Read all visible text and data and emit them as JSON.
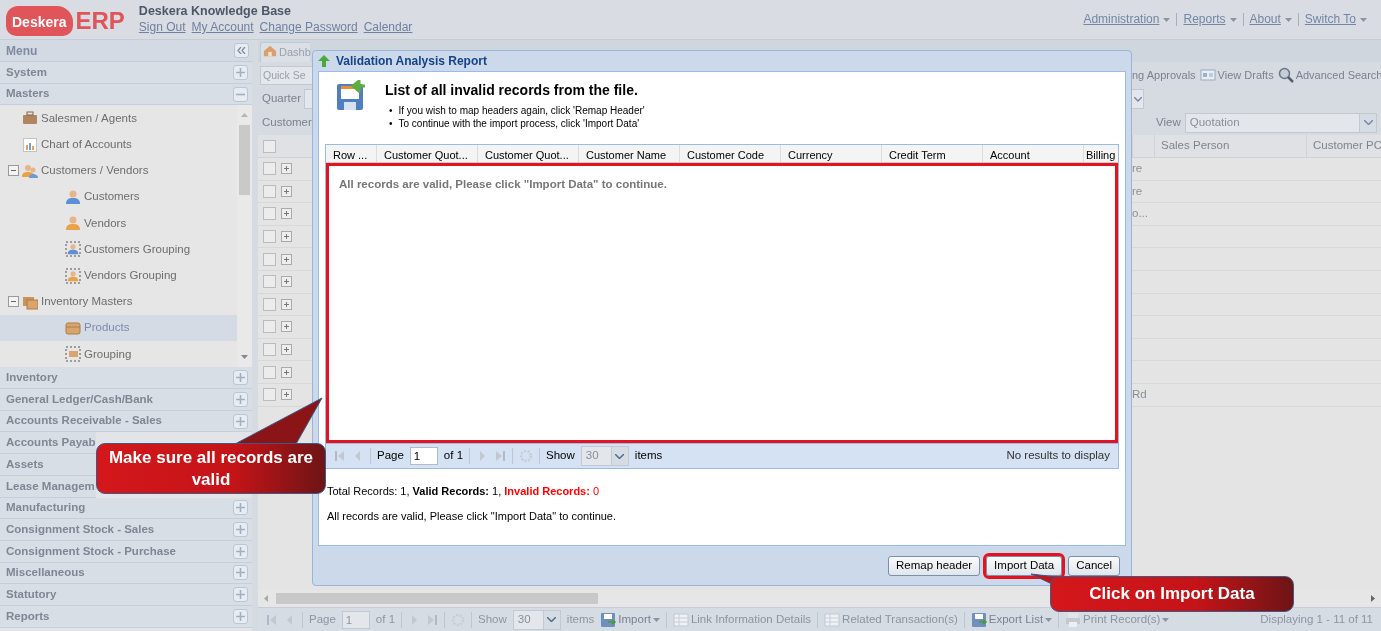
{
  "header": {
    "logo": {
      "wordmark": "Deskera",
      "suffix": "ERP"
    },
    "title": "Deskera Knowledge Base",
    "links": [
      "Sign Out",
      "My Account",
      "Change Password",
      "Calendar"
    ],
    "menu": [
      "Administration",
      "Reports",
      "About",
      "Switch To"
    ]
  },
  "sidebar": {
    "title": "Menu",
    "sections": [
      {
        "label": "System",
        "expanded": false
      },
      {
        "label": "Masters",
        "expanded": true,
        "children": [
          {
            "label": "Salesmen / Agents",
            "kind": "briefcase",
            "selected": false
          },
          {
            "label": "Chart of Accounts",
            "kind": "chart",
            "selected": false
          },
          {
            "label": "Customers / Vendors",
            "kind": "people",
            "selected": false,
            "expanded": true,
            "children": [
              {
                "label": "Customers",
                "kind": "customer",
                "selected": false
              },
              {
                "label": "Vendors",
                "kind": "vendor",
                "selected": false
              },
              {
                "label": "Customers Grouping",
                "kind": "customer-group",
                "selected": false
              },
              {
                "label": "Vendors Grouping",
                "kind": "vendor-group",
                "selected": false
              }
            ]
          },
          {
            "label": "Inventory Masters",
            "kind": "inventory",
            "selected": false,
            "expanded": true,
            "children": [
              {
                "label": "Products",
                "kind": "product",
                "selected": true
              },
              {
                "label": "Grouping",
                "kind": "group",
                "selected": false
              }
            ]
          }
        ]
      },
      {
        "label": "Inventory",
        "expanded": false
      },
      {
        "label": "General Ledger/Cash/Bank",
        "expanded": false
      },
      {
        "label": "Accounts Receivable - Sales",
        "expanded": false
      },
      {
        "label": "Accounts Payab"
      },
      {
        "label": "Assets"
      },
      {
        "label": "Lease Managem"
      },
      {
        "label": "Manufacturing",
        "expanded": false
      },
      {
        "label": "Consignment Stock - Sales",
        "expanded": false
      },
      {
        "label": "Consignment Stock - Purchase",
        "expanded": false
      },
      {
        "label": "Miscellaneous",
        "expanded": false
      },
      {
        "label": "Statutory",
        "expanded": false
      },
      {
        "label": "Reports",
        "expanded": false
      }
    ]
  },
  "tabs": [
    {
      "label": "Dashb",
      "selected": false,
      "kind": "dashboard"
    }
  ],
  "toolbar": {
    "search": {
      "placeholder": "Quick Se"
    },
    "actions": [
      "ng Approvals",
      "View Drafts",
      "Advanced Search"
    ],
    "quarter": {
      "label": "Quarter"
    },
    "customer_label": "Customer",
    "view": {
      "label": "View",
      "value": "Quotation"
    }
  },
  "grid": {
    "all_checked": false,
    "columns": [
      "Sales Person",
      "Customer PO"
    ],
    "rows": [
      {
        "checked": false,
        "column_1": "re"
      },
      {
        "checked": false,
        "column_1": "re"
      },
      {
        "checked": false,
        "column_1": "o..."
      },
      {
        "checked": false
      },
      {
        "checked": false
      },
      {
        "checked": false
      },
      {
        "checked": false
      },
      {
        "checked": false
      },
      {
        "checked": false
      },
      {
        "checked": false
      },
      {
        "checked": false,
        "column_1": "Rd"
      }
    ]
  },
  "pager": {
    "page_label": "Page",
    "page": "1",
    "of": "of 1",
    "show_label": "Show",
    "page_size": "30",
    "items_label": "items",
    "actions": [
      {
        "label": "Import",
        "disabled": false,
        "menu": true,
        "kind": "import"
      },
      {
        "label": "Link Information Details",
        "disabled": true,
        "menu": false,
        "kind": "sheet"
      },
      {
        "label": "Related Transaction(s)",
        "disabled": true,
        "menu": false,
        "kind": "sheet"
      },
      {
        "label": "Export List",
        "disabled": false,
        "menu": true,
        "kind": "import"
      },
      {
        "label": "Print Record(s)",
        "disabled": true,
        "menu": true,
        "kind": "print"
      }
    ],
    "status": "Displaying 1 - 11 of 11"
  },
  "dialog": {
    "title": "Validation Analysis Report",
    "heading": "List of all invalid records from the file.",
    "bullets": [
      {
        "marker": "•",
        "text": "If you wish to map headers again, click 'Remap Header'"
      },
      {
        "marker": "•",
        "text": "To continue with the import process, click 'Import Data'"
      }
    ],
    "columns": [
      "Row ...",
      "Customer Quot...",
      "Customer Quot...",
      "Customer Name",
      "Customer Code",
      "Currency",
      "Credit Term",
      "Account",
      "Billing"
    ],
    "empty_text": "All records are valid, Please click \"Import Data\" to continue.",
    "highlighted": true,
    "paging": {
      "page_label": "Page",
      "page": "1",
      "of": "of 1",
      "show_label": "Show",
      "page_size": "30",
      "items_label": "items",
      "status": "No results to display"
    },
    "summary": [
      {
        "text": "Total Records: 1, ",
        "kind": "plain"
      },
      {
        "text": "Valid Records:",
        "kind": "bold"
      },
      {
        "text": " 1, ",
        "kind": "plain"
      },
      {
        "text": "Invalid Records:",
        "kind": "error-bold"
      },
      {
        "text": " 0",
        "kind": "error"
      }
    ],
    "message": "All records are valid, Please click \"Import Data\" to continue.",
    "buttons": [
      {
        "label": "Remap header",
        "highlighted": false
      },
      {
        "label": "Import Data",
        "highlighted": true
      },
      {
        "label": "Cancel",
        "highlighted": false
      }
    ]
  },
  "callouts": [
    {
      "text": "Make sure all records are valid"
    },
    {
      "text": "Click on Import Data"
    }
  ]
}
